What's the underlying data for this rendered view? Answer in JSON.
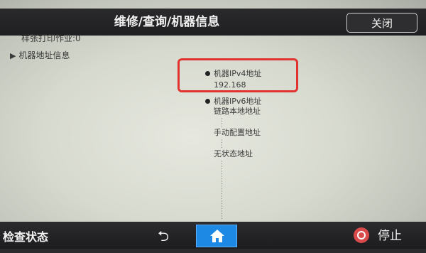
{
  "header": {
    "title": "维修/查询/机器信息",
    "close_label": "关闭"
  },
  "left_panel": {
    "sample_jobs": "样张打印作业:0",
    "address_info_label": "机器地址信息"
  },
  "ipv4": {
    "label": "机器IPv4地址",
    "value": "192.168"
  },
  "ipv6": {
    "label": "机器IPv6地址",
    "link_local": "链路本地地址",
    "manual": "手动配置地址",
    "stateless": "无状态地址"
  },
  "footer": {
    "status_label": "检查状态",
    "stop_label": "停止"
  },
  "colors": {
    "highlight": "#e0332f",
    "home_button": "#1e88e5",
    "stop_icon": "#d94a4a"
  },
  "icons": {
    "back": "back-arrow-icon",
    "home": "home-icon",
    "stop": "stop-icon"
  }
}
